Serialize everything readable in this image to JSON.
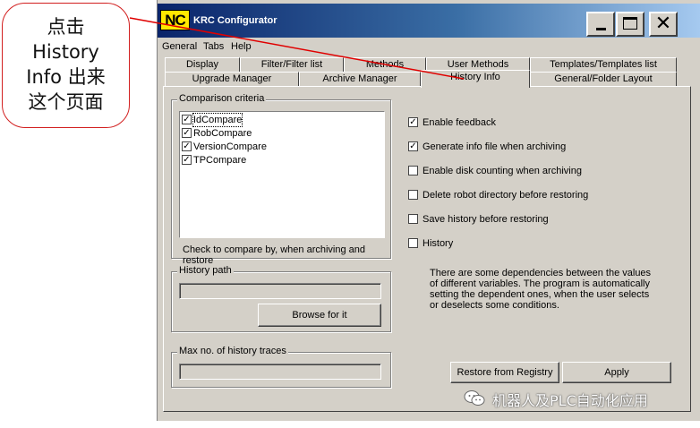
{
  "callout": {
    "text": "点击\nHistory\nInfo 出来\n这个页面",
    "color": "#d21f1f"
  },
  "window": {
    "logo": "NC",
    "title": "KRC Configurator",
    "buttons": {
      "minimize": "minimize-icon",
      "maximize": "maximize-icon",
      "close": "close-icon",
      "close_glyph": "✕"
    }
  },
  "menu": {
    "items": [
      "General",
      "Tabs",
      "Help"
    ]
  },
  "tabs": {
    "row1": [
      "Display",
      "Filter/Filter list",
      "Methods",
      "User Methods",
      "Templates/Templates list"
    ],
    "row2": [
      "Upgrade Manager",
      "Archive Manager",
      "History Info",
      "General/Folder Layout"
    ],
    "active": "History Info"
  },
  "comparison": {
    "label": "Comparison criteria",
    "items": [
      {
        "label": "IdCompare",
        "checked": true
      },
      {
        "label": "RobCompare",
        "checked": true
      },
      {
        "label": "VersionCompare",
        "checked": true
      },
      {
        "label": "TPCompare",
        "checked": true
      }
    ],
    "hint": "Check to compare by, when archiving and restore"
  },
  "history_path": {
    "label": "History path",
    "value": "",
    "browse": "Browse for it"
  },
  "max_traces": {
    "label": "Max no. of history traces",
    "value": ""
  },
  "options": [
    {
      "label": "Enable feedback",
      "checked": true
    },
    {
      "label": "Generate info file when archiving",
      "checked": true
    },
    {
      "label": "Enable disk counting when archiving",
      "checked": false
    },
    {
      "label": "Delete robot directory before restoring",
      "checked": false
    },
    {
      "label": "Save history before restoring",
      "checked": false
    },
    {
      "label": "History",
      "checked": false
    }
  ],
  "description": "There are some dependencies between the values of different variables. The program is automatically setting the dependent ones, when the user selects or deselects some conditions.",
  "actions": {
    "restore": "Restore from Registry",
    "apply": "Apply"
  },
  "watermark": {
    "text": "机器人及PLC自动化应用",
    "icon": "wechat-icon"
  }
}
